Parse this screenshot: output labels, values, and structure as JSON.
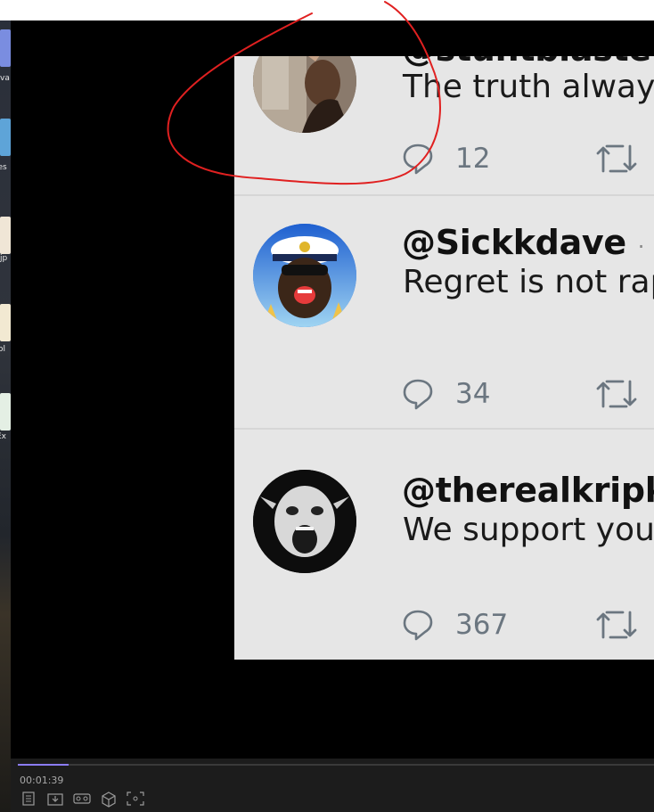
{
  "desktop": {
    "labels": [
      "va",
      "res",
      "jp",
      "ol",
      "Ex"
    ]
  },
  "tweets": [
    {
      "handle": "@stuntblaster",
      "separator": "",
      "text": "The truth always",
      "reply_count": "12",
      "avatar_icon": "woman-photo-avatar"
    },
    {
      "handle": "@Sickkdave",
      "separator": "·",
      "text": "Regret is not rap",
      "reply_count": "34",
      "avatar_icon": "captain-cartoon-avatar"
    },
    {
      "handle": "@therealkripk",
      "separator": "",
      "text": "We support you",
      "reply_count": "367",
      "avatar_icon": "screaming-face-avatar"
    }
  ],
  "player": {
    "timestamp": "00:01:39",
    "progress_fraction": 0.08,
    "controls": [
      "notes-icon",
      "download-icon",
      "vr-icon",
      "3d-box-icon",
      "screenshot-icon"
    ]
  },
  "colors": {
    "annotation": "#e02020",
    "progress": "#8b7cf6",
    "tweet_background": "#e6e6e6",
    "reply_count": "#6b7680"
  }
}
